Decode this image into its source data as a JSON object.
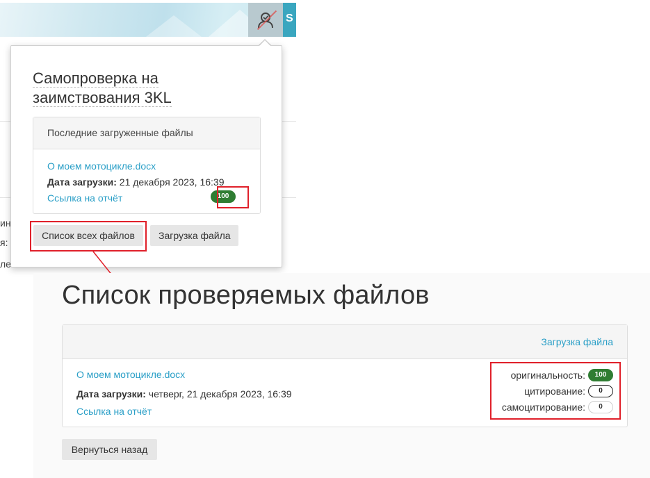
{
  "background": {
    "fragments": [
      "ина",
      "я: Р",
      "ле"
    ],
    "partial_nav_letter": "S"
  },
  "popup": {
    "title": "Самопроверка на заимствования 3KL",
    "recent_header": "Последние загруженные файлы",
    "file_name": "О моем мотоцикле.docx",
    "date_label": "Дата загрузки:",
    "date_value": "21 декабря 2023, 16:39",
    "report_link": "Ссылка на отчёт",
    "originality_badge": "100",
    "btn_all_files": "Список всех файлов",
    "btn_upload": "Загрузка файла"
  },
  "main": {
    "title": "Список проверяемых файлов",
    "upload_link": "Загрузка файла",
    "file_name": "О моем мотоцикле.docx",
    "date_label": "Дата загрузки:",
    "date_value": "четверг, 21 декабря 2023, 16:39",
    "report_link": "Ссылка на отчёт",
    "metrics": [
      {
        "label": "оригинальность:",
        "value": "100"
      },
      {
        "label": "цитирование:",
        "value": "0"
      },
      {
        "label": "самоцитирование:",
        "value": "0"
      }
    ],
    "btn_back": "Вернуться назад"
  },
  "colors": {
    "link": "#2a9fc7",
    "badge_green": "#2f7d32",
    "highlight": "#e0202a"
  }
}
